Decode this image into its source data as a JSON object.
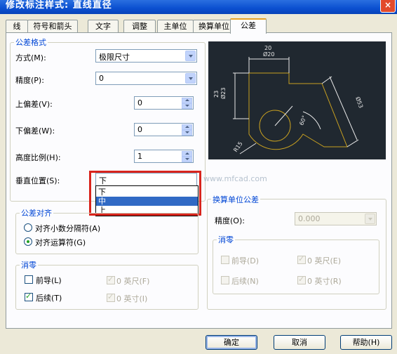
{
  "window": {
    "title": "修改标注样式: 直线直径",
    "close": "×"
  },
  "tabs": [
    "线",
    "符号和箭头",
    "文字",
    "调整",
    "主单位",
    "换算单位",
    "公差"
  ],
  "tolerance_format": {
    "group_label": "公差格式",
    "method_label": "方式(M):",
    "method_value": "极限尺寸",
    "precision_label": "精度(P):",
    "precision_value": "0",
    "upper_label": "上偏差(V):",
    "upper_value": "0",
    "lower_label": "下偏差(W):",
    "lower_value": "0",
    "scale_label": "高度比例(H):",
    "scale_value": "1",
    "vpos_label": "垂直位置(S):",
    "vpos_value": "下",
    "vpos_options": [
      "下",
      "中",
      "上"
    ],
    "vpos_selected": "中"
  },
  "alignment": {
    "group_label": "公差对齐",
    "opt1": "对齐小数分隔符(A)",
    "opt2": "对齐运算符(G)"
  },
  "zero_suppress": {
    "group_label": "消零",
    "leading": "前导(L)",
    "trailing": "后续(T)",
    "feet": "0 英尺(F)",
    "inches": "0 英寸(I)"
  },
  "alt_units": {
    "group_label": "换算单位公差",
    "precision_label": "精度(O):",
    "precision_value": "0.000",
    "zero_label": "消零",
    "leading": "前导(D)",
    "trailing": "后续(N)",
    "feet": "0 英尺(E)",
    "inches": "0 英寸(R)"
  },
  "watermark": "www.mfcad.com",
  "preview_labels": {
    "top1": "20",
    "top2": "Ø20",
    "left1": "23",
    "left2": "Ø23",
    "right": "Ø53",
    "angle": "60°",
    "radius": "R15"
  },
  "buttons": {
    "ok": "确定",
    "cancel": "取消",
    "help": "帮助(H)"
  }
}
